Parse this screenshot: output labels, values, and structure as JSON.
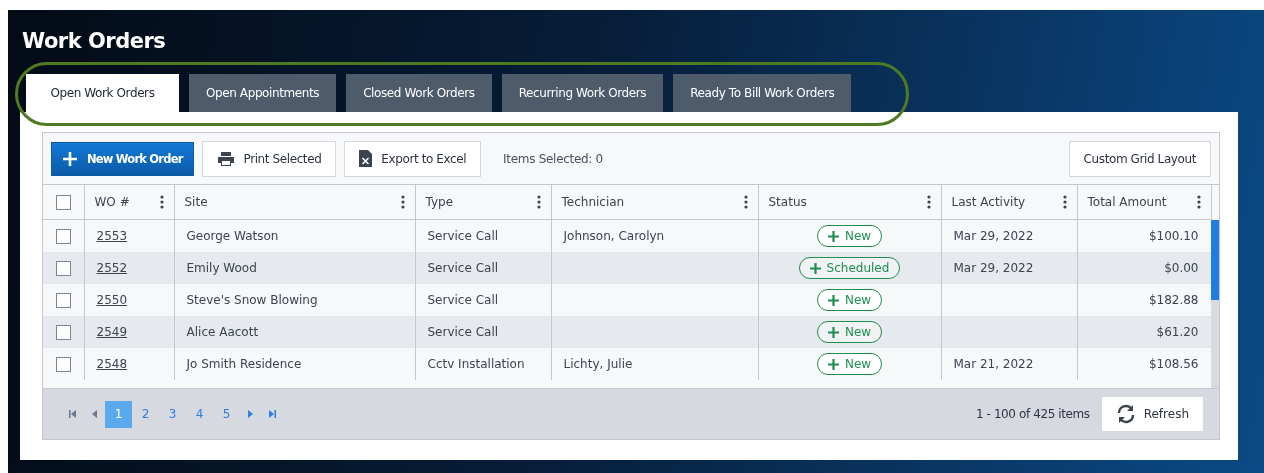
{
  "title": "Work Orders",
  "tabs": [
    {
      "label": "Open Work Orders",
      "selected": true
    },
    {
      "label": "Open Appointments",
      "selected": false
    },
    {
      "label": "Closed Work Orders",
      "selected": false
    },
    {
      "label": "Recurring Work Orders",
      "selected": false
    },
    {
      "label": "Ready To Bill Work Orders",
      "selected": false
    }
  ],
  "toolbar": {
    "new_button": "New Work Order",
    "print_button": "Print Selected",
    "export_button": "Export to Excel",
    "items_selected": "Items Selected: 0",
    "layout_button": "Custom Grid Layout"
  },
  "table": {
    "select_all_checked": false,
    "columns": [
      "WO #",
      "Site",
      "Type",
      "Technician",
      "Status",
      "Last Activity",
      "Total Amount"
    ],
    "rows": [
      {
        "checked": false,
        "wo": "2553",
        "site": "George Watson",
        "type": "Service Call",
        "technician": "Johnson, Carolyn",
        "status": "New",
        "last_activity": "Mar 29, 2022",
        "total": "$100.10"
      },
      {
        "checked": false,
        "wo": "2552",
        "site": "Emily Wood",
        "type": "Service Call",
        "technician": "",
        "status": "Scheduled",
        "last_activity": "Mar 29, 2022",
        "total": "$0.00"
      },
      {
        "checked": false,
        "wo": "2550",
        "site": "Steve's Snow Blowing",
        "type": "Service Call",
        "technician": "",
        "status": "New",
        "last_activity": "",
        "total": "$182.88"
      },
      {
        "checked": false,
        "wo": "2549",
        "site": "Alice Aacott",
        "type": "Service Call",
        "technician": "",
        "status": "New",
        "last_activity": "",
        "total": "$61.20"
      },
      {
        "checked": false,
        "wo": "2548",
        "site": "Jo Smith Residence",
        "type": "Cctv Installation",
        "technician": "Lichty, Julie",
        "status": "New",
        "last_activity": "Mar 21, 2022",
        "total": "$108.56"
      }
    ]
  },
  "pager": {
    "pages": [
      {
        "label": "1",
        "selected": true
      },
      {
        "label": "2",
        "selected": false
      },
      {
        "label": "3",
        "selected": false
      },
      {
        "label": "4",
        "selected": false
      },
      {
        "label": "5",
        "selected": false
      }
    ],
    "summary": "1 - 100 of 425 items",
    "refresh_button": "Refresh"
  }
}
